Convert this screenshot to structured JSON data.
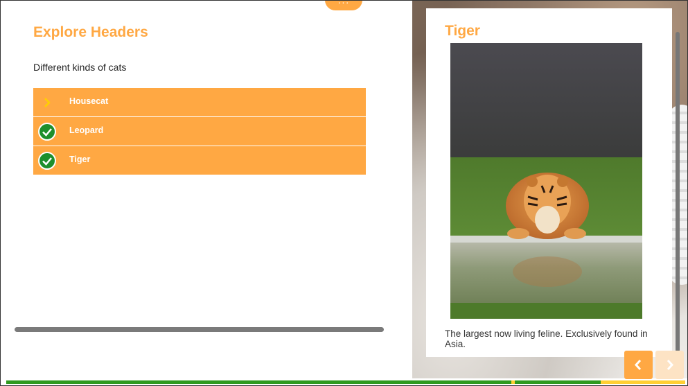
{
  "header": {
    "menu_label": "···"
  },
  "page": {
    "title": "Explore Headers",
    "subtitle": "Different kinds of cats"
  },
  "list": {
    "items": [
      {
        "label": "Housecat",
        "state": "current",
        "icon": "chevron-right-icon"
      },
      {
        "label": "Leopard",
        "state": "completed",
        "icon": "check-circle-icon"
      },
      {
        "label": "Tiger",
        "state": "completed",
        "icon": "check-circle-icon"
      }
    ]
  },
  "card": {
    "title": "Tiger",
    "description": "The largest now living feline. Exclusively found in Asia.",
    "image": "tiger-drinking-water-photo"
  },
  "nav": {
    "prev_icon": "chevron-left-icon",
    "next_icon": "chevron-right-icon",
    "next_enabled": false
  },
  "progress": {
    "value": 0.875
  },
  "colors": {
    "accent": "#ffa843",
    "complete": "#1d8f2c",
    "progress_fill": "#2f9a1f",
    "progress_track": "#ffcf33"
  }
}
